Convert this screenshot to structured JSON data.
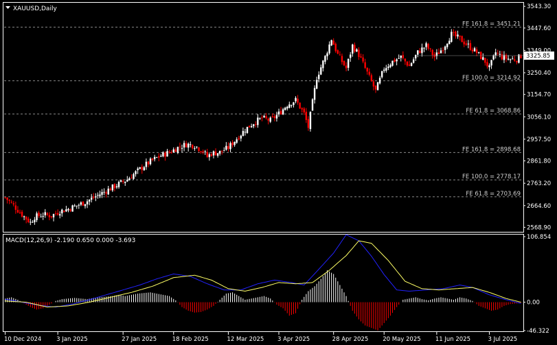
{
  "header": {
    "symbol_label": "XAUUSD,Daily"
  },
  "macd": {
    "label": "MACD(12,26,9) -2.190 0.650 0.000 -3.693"
  },
  "colors": {
    "background": "#000000",
    "up_candle": "#ffffff",
    "down_candle": "#ff0000",
    "macd_line": "#2222ff",
    "signal_line": "#ffff66",
    "hist_positive": "#ffffff",
    "hist_negative": "#ff0000",
    "fib_line": "#8c8c8c"
  },
  "chart_data": [
    {
      "type": "candlestick",
      "symbol": "XAUUSD",
      "timeframe": "Daily",
      "y_ticks": [
        "3543.30",
        "3447.60",
        "3349.00",
        "3250.40",
        "3154.70",
        "3056.10",
        "2957.50",
        "2861.80",
        "2763.20",
        "2664.60",
        "2568.90"
      ],
      "ylim": [
        2555,
        3553
      ],
      "current_price": "3325.85",
      "fib_levels": [
        {
          "label": "FE 161.8 = 3451.21",
          "value": 3451.21
        },
        {
          "label": "FE 100.0 = 3214.92",
          "value": 3214.92
        },
        {
          "label": "FE 61.8 = 3068.86",
          "value": 3068.86
        },
        {
          "label": "FE 161.8 = 2898.68",
          "value": 2898.68
        },
        {
          "label": "FE 100.0 = 2778.17",
          "value": 2778.17
        },
        {
          "label": "FE 61.8 = 2703.69",
          "value": 2703.69
        }
      ],
      "close_path": [
        [
          0,
          2700
        ],
        [
          4,
          2665
        ],
        [
          8,
          2625
        ],
        [
          12,
          2590
        ],
        [
          14,
          2615
        ],
        [
          18,
          2625
        ],
        [
          22,
          2620
        ],
        [
          26,
          2640
        ],
        [
          30,
          2650
        ],
        [
          34,
          2665
        ],
        [
          38,
          2680
        ],
        [
          42,
          2700
        ],
        [
          46,
          2720
        ],
        [
          50,
          2740
        ],
        [
          54,
          2760
        ],
        [
          58,
          2780
        ],
        [
          62,
          2810
        ],
        [
          66,
          2840
        ],
        [
          70,
          2865
        ],
        [
          74,
          2885
        ],
        [
          78,
          2900
        ],
        [
          82,
          2920
        ],
        [
          86,
          2935
        ],
        [
          90,
          2930
        ],
        [
          94,
          2905
        ],
        [
          96,
          2880
        ],
        [
          98,
          2895
        ],
        [
          102,
          2900
        ],
        [
          106,
          2920
        ],
        [
          110,
          2960
        ],
        [
          114,
          3000
        ],
        [
          118,
          3030
        ],
        [
          122,
          3050
        ],
        [
          126,
          3040
        ],
        [
          130,
          3070
        ],
        [
          134,
          3110
        ],
        [
          138,
          3130
        ],
        [
          142,
          3070
        ],
        [
          144,
          3010
        ],
        [
          146,
          3120
        ],
        [
          148,
          3230
        ],
        [
          152,
          3320
        ],
        [
          155,
          3400
        ],
        [
          158,
          3330
        ],
        [
          162,
          3270
        ],
        [
          165,
          3370
        ],
        [
          168,
          3330
        ],
        [
          172,
          3250
        ],
        [
          176,
          3170
        ],
        [
          180,
          3270
        ],
        [
          184,
          3300
        ],
        [
          188,
          3320
        ],
        [
          192,
          3280
        ],
        [
          196,
          3340
        ],
        [
          200,
          3370
        ],
        [
          204,
          3320
        ],
        [
          208,
          3360
        ],
        [
          212,
          3420
        ],
        [
          216,
          3400
        ],
        [
          220,
          3370
        ],
        [
          224,
          3340
        ],
        [
          228,
          3300
        ],
        [
          230,
          3270
        ],
        [
          233,
          3340
        ],
        [
          236,
          3320
        ],
        [
          240,
          3310
        ],
        [
          243,
          3310
        ],
        [
          245,
          3325
        ]
      ]
    },
    {
      "type": "line",
      "title": "MACD(12,26,9) -2.190 0.650 0.000 -3.693",
      "y_ticks": [
        "106.854",
        "0.00",
        "-46.322"
      ],
      "ylim": [
        -46.322,
        106.854
      ],
      "series": [
        {
          "name": "MACD",
          "points": [
            [
              0,
              5
            ],
            [
              8,
              0
            ],
            [
              16,
              -5
            ],
            [
              24,
              -8
            ],
            [
              32,
              -3
            ],
            [
              40,
              4
            ],
            [
              48,
              12
            ],
            [
              56,
              20
            ],
            [
              64,
              28
            ],
            [
              72,
              38
            ],
            [
              80,
              46
            ],
            [
              88,
              42
            ],
            [
              96,
              30
            ],
            [
              104,
              20
            ],
            [
              112,
              20
            ],
            [
              120,
              30
            ],
            [
              128,
              36
            ],
            [
              136,
              32
            ],
            [
              142,
              28
            ],
            [
              148,
              50
            ],
            [
              156,
              80
            ],
            [
              162,
              110
            ],
            [
              168,
              100
            ],
            [
              174,
              75
            ],
            [
              180,
              45
            ],
            [
              186,
              20
            ],
            [
              192,
              18
            ],
            [
              200,
              20
            ],
            [
              208,
              22
            ],
            [
              216,
              28
            ],
            [
              222,
              24
            ],
            [
              230,
              12
            ],
            [
              238,
              4
            ],
            [
              245,
              -2
            ]
          ]
        },
        {
          "name": "Signal",
          "points": [
            [
              0,
              2
            ],
            [
              10,
              0
            ],
            [
              20,
              -8
            ],
            [
              30,
              -6
            ],
            [
              40,
              0
            ],
            [
              50,
              8
            ],
            [
              60,
              16
            ],
            [
              70,
              26
            ],
            [
              80,
              40
            ],
            [
              90,
              44
            ],
            [
              98,
              36
            ],
            [
              106,
              22
            ],
            [
              114,
              18
            ],
            [
              122,
              24
            ],
            [
              130,
              32
            ],
            [
              138,
              30
            ],
            [
              146,
              32
            ],
            [
              154,
              52
            ],
            [
              162,
              76
            ],
            [
              168,
              100
            ],
            [
              174,
              96
            ],
            [
              182,
              68
            ],
            [
              190,
              34
            ],
            [
              198,
              22
            ],
            [
              206,
              20
            ],
            [
              214,
              22
            ],
            [
              222,
              24
            ],
            [
              230,
              16
            ],
            [
              238,
              6
            ],
            [
              245,
              0
            ]
          ]
        }
      ],
      "histogram": [
        [
          0,
          6
        ],
        [
          3,
          8
        ],
        [
          6,
          4
        ],
        [
          9,
          -2
        ],
        [
          12,
          -8
        ],
        [
          15,
          -12
        ],
        [
          18,
          -10
        ],
        [
          21,
          -4
        ],
        [
          24,
          2
        ],
        [
          27,
          5
        ],
        [
          30,
          6
        ],
        [
          33,
          7
        ],
        [
          36,
          6
        ],
        [
          39,
          5
        ],
        [
          42,
          7
        ],
        [
          45,
          8
        ],
        [
          48,
          9
        ],
        [
          51,
          10
        ],
        [
          54,
          12
        ],
        [
          57,
          10
        ],
        [
          60,
          12
        ],
        [
          63,
          14
        ],
        [
          66,
          15
        ],
        [
          69,
          16
        ],
        [
          72,
          14
        ],
        [
          75,
          12
        ],
        [
          78,
          10
        ],
        [
          81,
          3
        ],
        [
          84,
          -8
        ],
        [
          87,
          -14
        ],
        [
          90,
          -17
        ],
        [
          93,
          -16
        ],
        [
          96,
          -12
        ],
        [
          99,
          -6
        ],
        [
          102,
          4
        ],
        [
          105,
          14
        ],
        [
          108,
          16
        ],
        [
          111,
          10
        ],
        [
          114,
          4
        ],
        [
          117,
          6
        ],
        [
          120,
          8
        ],
        [
          123,
          10
        ],
        [
          126,
          6
        ],
        [
          129,
          -4
        ],
        [
          132,
          -10
        ],
        [
          135,
          -22
        ],
        [
          138,
          -18
        ],
        [
          141,
          4
        ],
        [
          144,
          18
        ],
        [
          147,
          26
        ],
        [
          150,
          38
        ],
        [
          153,
          52
        ],
        [
          156,
          46
        ],
        [
          159,
          28
        ],
        [
          162,
          10
        ],
        [
          165,
          -14
        ],
        [
          168,
          -28
        ],
        [
          171,
          -38
        ],
        [
          174,
          -42
        ],
        [
          177,
          -46
        ],
        [
          180,
          -34
        ],
        [
          183,
          -22
        ],
        [
          186,
          -8
        ],
        [
          189,
          4
        ],
        [
          192,
          6
        ],
        [
          195,
          8
        ],
        [
          198,
          5
        ],
        [
          201,
          3
        ],
        [
          204,
          6
        ],
        [
          207,
          8
        ],
        [
          210,
          6
        ],
        [
          213,
          4
        ],
        [
          216,
          8
        ],
        [
          219,
          6
        ],
        [
          222,
          2
        ],
        [
          225,
          -6
        ],
        [
          228,
          -10
        ],
        [
          231,
          -14
        ],
        [
          234,
          -12
        ],
        [
          237,
          -6
        ],
        [
          240,
          -3
        ],
        [
          243,
          -2
        ],
        [
          245,
          -1
        ]
      ]
    }
  ],
  "x_axis": {
    "labels": [
      {
        "text": "10 Dec 2024",
        "at": 0
      },
      {
        "text": "3 Jan 2025",
        "at": 25
      },
      {
        "text": "27 Jan 2025",
        "at": 56
      },
      {
        "text": "18 Feb 2025",
        "at": 80
      },
      {
        "text": "12 Mar 2025",
        "at": 106
      },
      {
        "text": "3 Apr 2025",
        "at": 130
      },
      {
        "text": "28 Apr 2025",
        "at": 156
      },
      {
        "text": "20 May 2025",
        "at": 180
      },
      {
        "text": "11 Jun 2025",
        "at": 205
      },
      {
        "text": "3 Jul 2025",
        "at": 230
      }
    ]
  }
}
